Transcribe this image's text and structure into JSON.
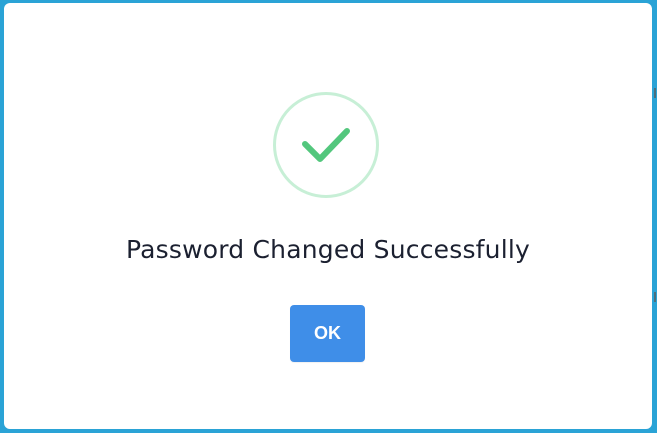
{
  "dialog": {
    "title": "Password Changed Successfully",
    "ok_label": "OK",
    "icon": "success-check-icon"
  },
  "colors": {
    "frame_accent": "#2aa3d6",
    "success_green": "#53c77d",
    "success_ring": "#c7efd6",
    "button_blue": "#3f8ee8",
    "text_dark": "#1b2030"
  }
}
